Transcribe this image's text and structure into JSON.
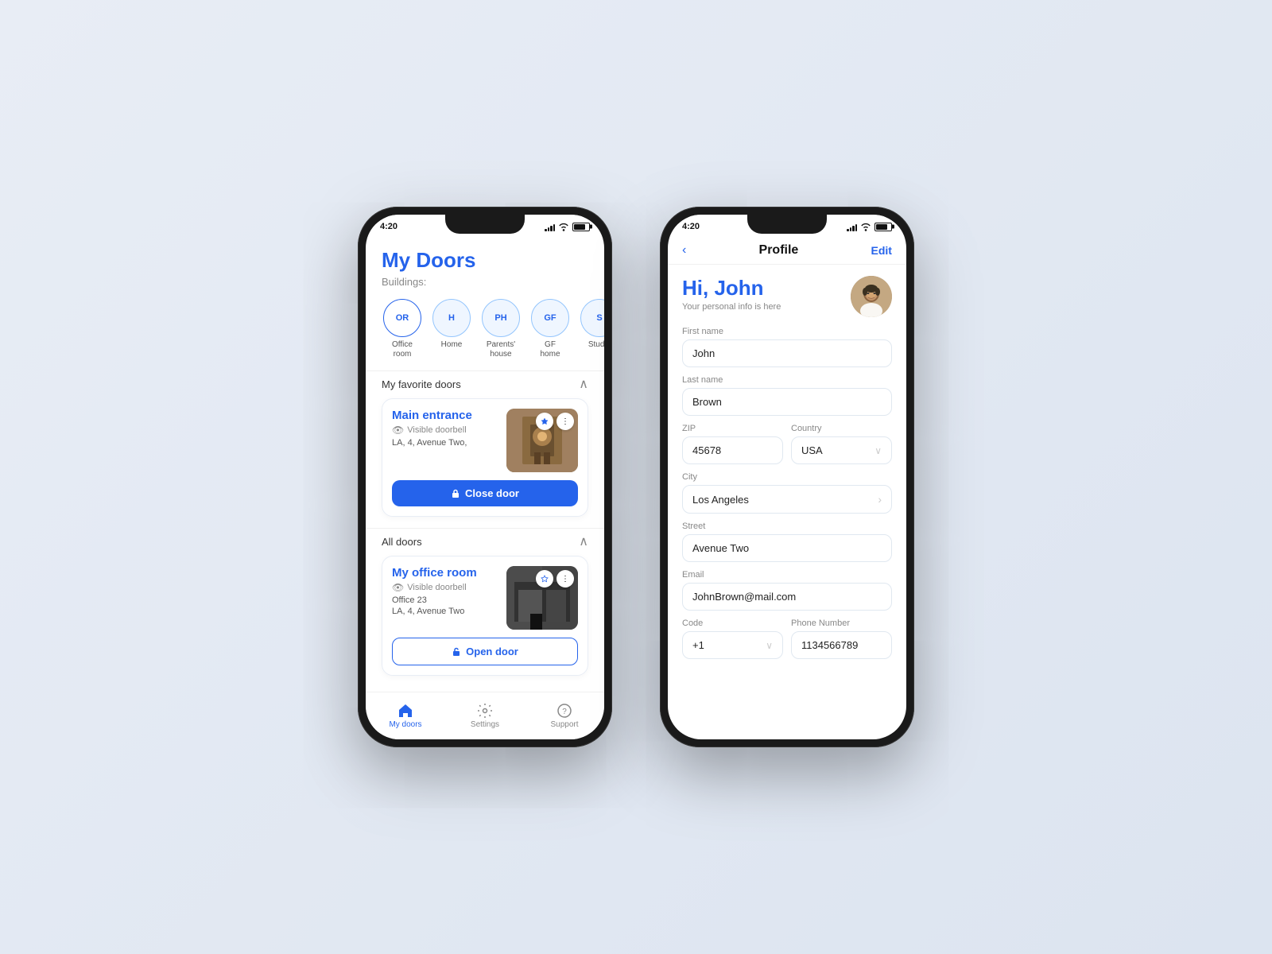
{
  "phone1": {
    "status_time": "4:20",
    "title": "My Doors",
    "buildings_label": "Buildings:",
    "buildings": [
      {
        "initials": "OR",
        "label": "Office\nroom",
        "active": true
      },
      {
        "initials": "H",
        "label": "Home",
        "active": false
      },
      {
        "initials": "PH",
        "label": "Parents'\nhouse",
        "active": false
      },
      {
        "initials": "GF",
        "label": "GF\nhome",
        "active": false
      },
      {
        "initials": "S",
        "label": "Studio",
        "active": false
      }
    ],
    "favorite_section": "My favorite doors",
    "favorite_door": {
      "name": "Main entrance",
      "type": "Visible doorbell",
      "address": "LA, 4, Avenue Two,",
      "action": "Close door"
    },
    "all_doors_section": "All doors",
    "all_door": {
      "name": "My office room",
      "type": "Visible doorbell",
      "address_line1": "Office 23",
      "address_line2": "LA, 4, Avenue Two",
      "action": "Open door"
    },
    "nav": [
      {
        "label": "My doors",
        "active": true
      },
      {
        "label": "Settings",
        "active": false
      },
      {
        "label": "Support",
        "active": false
      }
    ]
  },
  "phone2": {
    "status_time": "4:20",
    "back_label": "‹",
    "title": "Profile",
    "edit_label": "Edit",
    "greeting": "Hi, John",
    "subtitle": "Your personal info is here",
    "fields": {
      "first_name_label": "First name",
      "first_name_value": "John",
      "last_name_label": "Last name",
      "last_name_value": "Brown",
      "zip_label": "ZIP",
      "zip_value": "45678",
      "country_label": "Country",
      "country_value": "USA",
      "city_label": "City",
      "city_value": "Los Angeles",
      "street_label": "Street",
      "street_value": "Avenue Two",
      "email_label": "Email",
      "email_value": "JohnBrown@mail.com",
      "code_label": "Code",
      "code_value": "+1",
      "phone_label": "Phone Number",
      "phone_value": "1134566789"
    }
  }
}
